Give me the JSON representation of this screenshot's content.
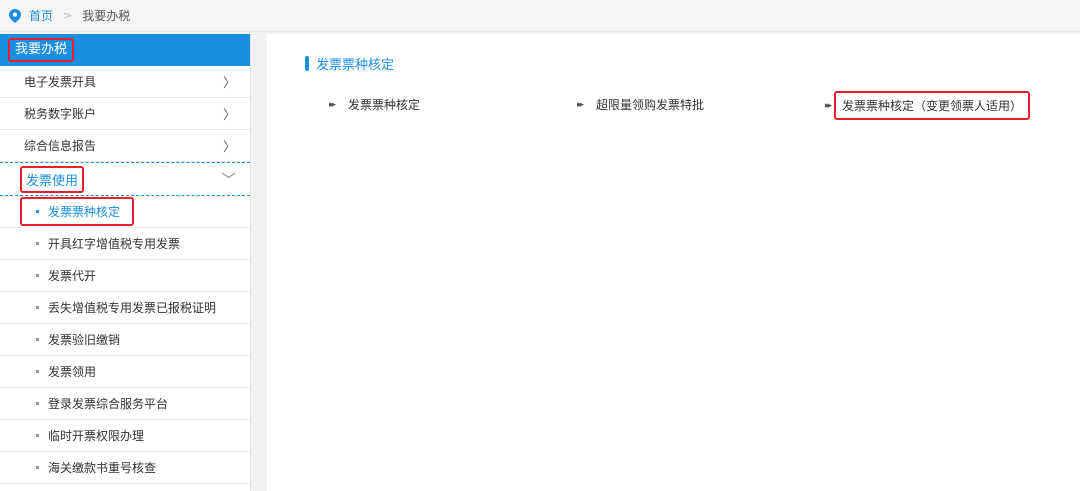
{
  "breadcrumb": {
    "home": "首页",
    "separator": ">",
    "current": "我要办税"
  },
  "sidebar": {
    "header": "我要办税",
    "items": [
      {
        "label": "电子发票开具",
        "chevron": "〉"
      },
      {
        "label": "税务数字账户",
        "chevron": "〉"
      },
      {
        "label": "综合信息报告",
        "chevron": "〉"
      }
    ],
    "open_item": {
      "label": "发票使用",
      "chevron": "﹀"
    },
    "sub_items": [
      {
        "label": "发票票种核定"
      },
      {
        "label": "开具红字增值税专用发票"
      },
      {
        "label": "发票代开"
      },
      {
        "label": "丢失增值税专用发票已报税证明"
      },
      {
        "label": "发票验旧缴销"
      },
      {
        "label": "发票领用"
      },
      {
        "label": "登录发票综合服务平台"
      },
      {
        "label": "临时开票权限办理"
      },
      {
        "label": "海关缴款书重号核查"
      }
    ]
  },
  "main": {
    "section_title": "发票票种核定",
    "links": [
      {
        "label": "发票票种核定"
      },
      {
        "label": "超限量领购发票特批"
      },
      {
        "label": "发票票种核定（变更领票人适用）"
      }
    ]
  },
  "colors": {
    "accent": "#1a8fe0",
    "highlight_box": "#e8202a"
  }
}
